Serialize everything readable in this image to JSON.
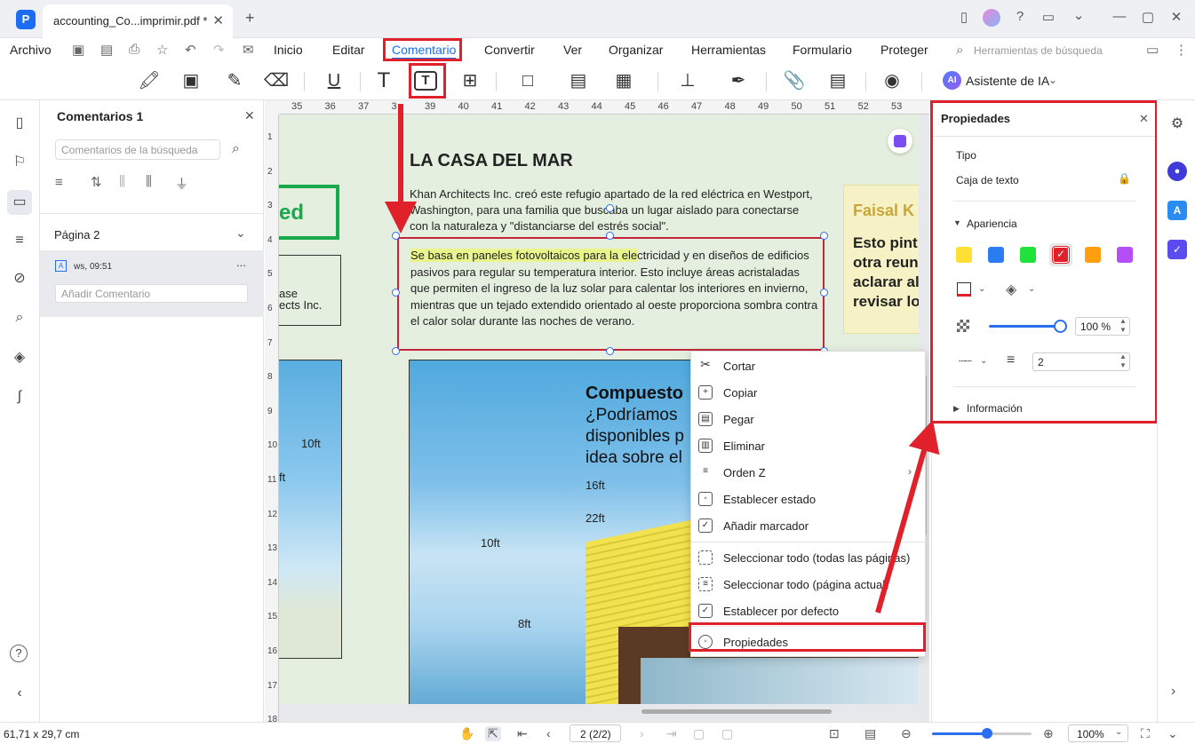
{
  "titlebar": {
    "tab_title": "accounting_Co...imprimir.pdf *",
    "close_glyph": "✕",
    "new_tab_glyph": "+"
  },
  "menubar": {
    "archivo": "Archivo",
    "items": [
      "Inicio",
      "Editar",
      "Comentario",
      "Convertir",
      "Ver",
      "Organizar",
      "Herramientas",
      "Formulario",
      "Proteger"
    ],
    "search_placeholder": "Herramientas de búsqueda"
  },
  "toolbar": {
    "ai_label": "Asistente de IA",
    "ai_badge": "AI"
  },
  "comments_panel": {
    "title": "Comentarios 1",
    "search_placeholder": "Comentarios de la búsqueda",
    "page_label": "Página 2",
    "comment_author": "ws,",
    "comment_time": "09:51",
    "comment_more": "...",
    "add_comment_placeholder": "Añadir Comentario"
  },
  "ruler": {
    "h_ticks": [
      "35",
      "36",
      "37",
      "3",
      "39",
      "40",
      "41",
      "42",
      "43",
      "44",
      "45",
      "46",
      "47",
      "48",
      "49",
      "50",
      "51",
      "52",
      "53"
    ],
    "v_ticks": [
      "1",
      "2",
      "3",
      "4",
      "5",
      "6",
      "7",
      "8",
      "9",
      "10",
      "11",
      "12",
      "13",
      "14",
      "15",
      "16",
      "17",
      "18"
    ]
  },
  "document": {
    "heading": "LA CASA DEL MAR",
    "para1": "Khan Architects Inc. creó este refugio apartado de la red eléctrica en Westport, Washington, para una familia que buscaba un lugar aislado para conectarse con la naturaleza y \"distanciarse del estrés social\".",
    "highlight": "Se basa en paneles fotovoltaicos para la ele",
    "para2_rest": "ctricidad y en diseños de edificios pasivos para regular su temperatura interior. Esto incluye áreas acristaladas que permiten el ingreso de la luz solar para calentar los interiores en invierno, mientras que un tejado extendido orientado al oeste proporciona sombra contra el calor solar durante las noches de verano.",
    "left_green_text": "ed",
    "left_box_text1": "ase",
    "left_box_text2": "ects Inc.",
    "left_dim1": "10ft",
    "left_dim2": "ft",
    "right_card_title": "Faisal K",
    "right_card_body": "Esto pint otra reun aclarar al revisar lo",
    "image_title": "Compuesto",
    "image_body": "¿Podríamos disponibles p idea sobre el",
    "dim_16ft": "16ft",
    "dim_22ft": "22ft",
    "dim_10ft": "10ft",
    "dim_8ft": "8ft"
  },
  "context_menu": {
    "items": [
      "Cortar",
      "Copiar",
      "Pegar",
      "Eliminar",
      "Orden Z",
      "Establecer estado",
      "Añadir marcador",
      "Seleccionar todo (todas las páginas)",
      "Seleccionar todo (página actual)",
      "Establecer por defecto",
      "Propiedades"
    ]
  },
  "properties": {
    "title": "Propiedades",
    "type_label": "Tipo",
    "type_value": "Caja de texto",
    "appearance": "Apariencia",
    "opacity": "100 %",
    "border_width": "2",
    "info": "Información",
    "swatch_colors": [
      "#ffe033",
      "#2a7cf0",
      "#1fe23a",
      "#ffffff",
      "#ff9f0f",
      "#b44ff5"
    ]
  },
  "statusbar": {
    "dimensions": "61,71 x 29,7 cm",
    "page_field": "2 (2/2)",
    "zoom": "100%",
    "zoom_level": 0.55
  },
  "colors": {
    "accent": "#1b6ef3",
    "annotation_red": "#e0202a",
    "textbox_border": "#c4253b",
    "highlight": "#e9f58a"
  }
}
